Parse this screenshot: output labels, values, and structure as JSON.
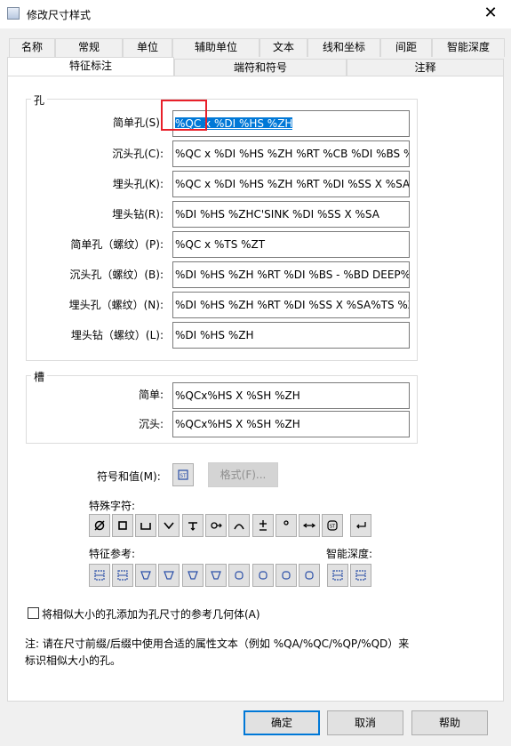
{
  "window": {
    "title": "修改尺寸样式",
    "close_symbol": "✕"
  },
  "tabs_row1": [
    "名称",
    "常规",
    "单位",
    "辅助单位",
    "文本",
    "线和坐标",
    "间距",
    "智能深度"
  ],
  "tabs_row2": [
    "特征标注",
    "端符和符号",
    "注释"
  ],
  "hole_group": {
    "title": "孔",
    "fields": [
      {
        "label": "简单孔(S):",
        "selected": "%QC x %DI %HS %ZH",
        "value": ""
      },
      {
        "label": "沉头孔(C):",
        "value": "%QC x %DI %HS %ZH %RT %CB %DI %BS %"
      },
      {
        "label": "埋头孔(K):",
        "value": "%QC x %DI %HS %ZH %RT %DI %SS X %SA"
      },
      {
        "label": "埋头钻(R):",
        "value": "%DI %HS %ZHC'SINK %DI %SS X %SA"
      },
      {
        "label": "简单孔（螺纹）(P):",
        "value": "%QC x %TS %ZT"
      },
      {
        "label": "沉头孔（螺纹）(B):",
        "value": "%DI %HS %ZH %RT  %DI %BS - %BD DEEP%"
      },
      {
        "label": "埋头孔（螺纹）(N):",
        "value": "%DI %HS %ZH %RT  %DI %SS X %SA%TS %Z"
      },
      {
        "label": "埋头钻（螺纹）(L):",
        "value": "%DI %HS %ZH"
      }
    ]
  },
  "slot_group": {
    "title": "槽",
    "fields": [
      {
        "label": "简单:",
        "value": "%QCx%HS X %SH %ZH"
      },
      {
        "label": "沉头:",
        "value": "%QCx%HS X %SH %ZH"
      }
    ]
  },
  "symbol_value": {
    "label": "符号和值(M):",
    "format_button": "格式(F)..."
  },
  "special_chars": {
    "label": "特殊字符:",
    "icons": [
      "diameter-icon",
      "square-icon",
      "counterbore-icon",
      "countersink-icon",
      "depth-icon",
      "tapped-hole-icon",
      "arc-icon",
      "plus-minus-icon",
      "degree-icon",
      "slot-arrow-icon",
      "symbol-library-icon",
      "line-break-icon"
    ]
  },
  "feature_ref": {
    "label": "特征参考:",
    "icons": [
      "hole-ref-1-icon",
      "hole-ref-2-icon",
      "cbore-ref-icon",
      "cbore-depth-ref-icon",
      "csink-ref-icon",
      "csink-ref-2-icon",
      "slot-ref-1-icon",
      "slot-ref-2-icon",
      "slot-ref-3-icon",
      "slot-ref-4-icon"
    ]
  },
  "smart_depth": {
    "label": "智能深度:",
    "icons": [
      "smart-depth-1-icon",
      "smart-depth-2-icon"
    ]
  },
  "checkbox": {
    "label": "将相似大小的孔添加为孔尺寸的参考几何体(A)",
    "checked": false
  },
  "note": {
    "line1": "注: 请在尺寸前缀/后缀中使用合适的属性文本（例如 %QA/%QC/%QP/%QD）来",
    "line2": "标识相似大小的孔。"
  },
  "buttons": {
    "ok": "确定",
    "cancel": "取消",
    "help": "帮助"
  },
  "colors": {
    "selection": "#0078d7",
    "highlight_box": "#e8202a"
  }
}
